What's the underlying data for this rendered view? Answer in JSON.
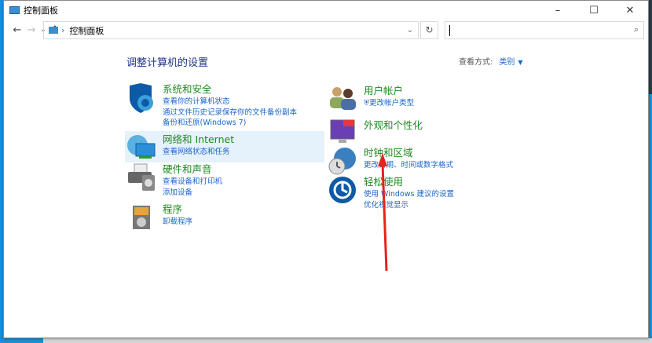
{
  "window": {
    "title": "控制面板",
    "minimize": "–",
    "maximize": "☐",
    "close": "✕"
  },
  "nav": {
    "back": "←",
    "forward": "→",
    "recent": "⌄",
    "up": "↑",
    "breadcrumb": "控制面板",
    "dropdown": "⌄",
    "refresh": "↻",
    "search_value": "",
    "search_icon": "⌕"
  },
  "main": {
    "heading": "调整计算机的设置",
    "view_by_label": "查看方式:",
    "view_by_value": "类别"
  },
  "categories": [
    {
      "title": "系统和安全",
      "icon": "shield-icon",
      "links": [
        "查看你的计算机状态",
        "通过文件历史记录保存你的文件备份副本",
        "备份和还原(Windows 7)"
      ]
    },
    {
      "title": "网络和 Internet",
      "icon": "network-icon",
      "links": [
        "查看网络状态和任务"
      ]
    },
    {
      "title": "硬件和声音",
      "icon": "printer-icon",
      "links": [
        "查看设备和打印机",
        "添加设备"
      ]
    },
    {
      "title": "程序",
      "icon": "programs-icon",
      "links": [
        "卸载程序"
      ]
    },
    {
      "title": "用户帐户",
      "icon": "users-icon",
      "links": [
        "更改帐户类型"
      ]
    },
    {
      "title": "外观和个性化",
      "icon": "monitor-icon",
      "links": []
    },
    {
      "title": "时钟和区域",
      "icon": "clock-globe-icon",
      "links": [
        "更改日期、时间或数字格式"
      ]
    },
    {
      "title": "轻松使用",
      "icon": "ease-of-access-icon",
      "links": [
        "使用 Windows 建议的设置",
        "优化视觉显示"
      ]
    }
  ],
  "colors": {
    "accent": "#1a66c8",
    "category_title": "#1f8a1f",
    "heading": "#1e3287",
    "annotation_arrow": "#e8211a"
  }
}
